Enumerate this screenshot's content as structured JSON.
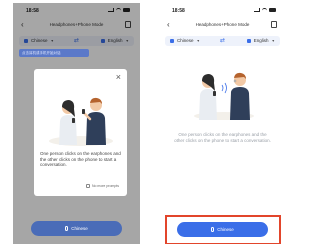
{
  "status": {
    "time": "18:58"
  },
  "nav": {
    "title": "Headphones+Phone Mode",
    "back_icon": "arrow-left-icon",
    "doc_icon": "document-icon"
  },
  "languages": {
    "source": "Chinese",
    "target": "English"
  },
  "left_screen": {
    "hint_strip": "点击耳机或手机开始对话",
    "modal": {
      "text": "One person clicks on the earphones and the other clicks on the phone to start a conversation.",
      "no_more_prompts": "No more prompts"
    },
    "button_label": "Chinese"
  },
  "right_screen": {
    "caption": "One person clicks on the earphones and the other clicks on the phone to start a conversation.",
    "button_label": "Chinese"
  },
  "colors": {
    "accent": "#3a6ee8",
    "highlight": "#e2452b"
  }
}
